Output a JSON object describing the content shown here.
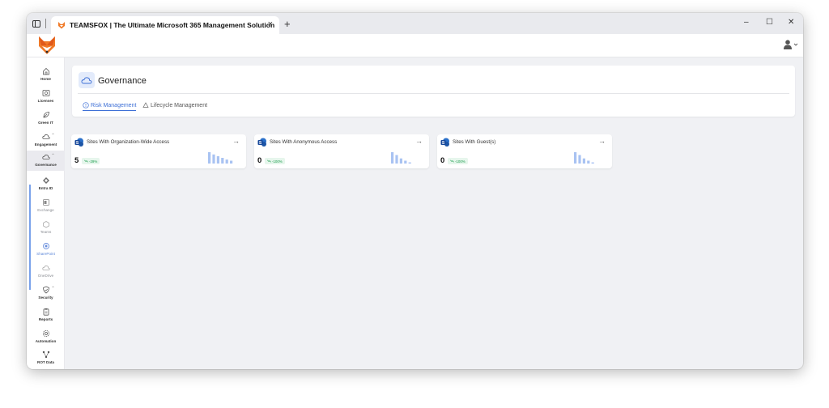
{
  "browser": {
    "tab_title": "TEAMSFOX | The Ultimate Microsoft 365 Management Solution",
    "close_glyph": "×",
    "new_tab_glyph": "+",
    "minimize_glyph": "–",
    "maximize_glyph": "☐",
    "window_close_glyph": "✕"
  },
  "sidebar": {
    "items": [
      {
        "label": "Home",
        "icon": "home-icon"
      },
      {
        "label": "Licenses",
        "icon": "license-icon"
      },
      {
        "label": "Green IT",
        "icon": "leaf-icon"
      },
      {
        "label": "Engagement",
        "icon": "cloud-icon"
      },
      {
        "label": "Governance",
        "icon": "cloud-icon"
      },
      {
        "label": "Entra ID",
        "icon": "diamond-icon"
      },
      {
        "label": "Exchange",
        "icon": "exchange-icon"
      },
      {
        "label": "Teams",
        "icon": "teams-icon"
      },
      {
        "label": "SharePoint",
        "icon": "sharepoint-icon"
      },
      {
        "label": "OneDrive",
        "icon": "onedrive-icon"
      },
      {
        "label": "Security",
        "icon": "shield-icon"
      },
      {
        "label": "Reports",
        "icon": "clipboard-icon"
      },
      {
        "label": "Automation",
        "icon": "gear-icon"
      },
      {
        "label": "ROT Data",
        "icon": "nodes-icon"
      }
    ],
    "caret_glyph": "⌃"
  },
  "governance": {
    "title": "Governance",
    "tabs": [
      {
        "label": "Risk Management",
        "active": true
      },
      {
        "label": "Lifecycle Management",
        "active": false
      }
    ]
  },
  "cards": [
    {
      "title": "Sites With Organization-Wide Access",
      "value": "5",
      "trend": "-29%",
      "bars": [
        1.0,
        0.8,
        0.65,
        0.5,
        0.35,
        0.25
      ]
    },
    {
      "title": "Sites With Anonymous Access",
      "value": "0",
      "trend": "-100%",
      "bars": [
        1.0,
        0.75,
        0.45,
        0.25,
        0.1
      ]
    },
    {
      "title": "Sites With Guest(s)",
      "value": "0",
      "trend": "-100%",
      "bars": [
        1.0,
        0.75,
        0.45,
        0.25,
        0.1
      ]
    }
  ],
  "arrow_glyph": "→",
  "colors": {
    "accent": "#3e70d6",
    "bars": "#a9c3f2",
    "trend_green": "#1d9d4e",
    "sharepoint": "#2a6fc9"
  }
}
